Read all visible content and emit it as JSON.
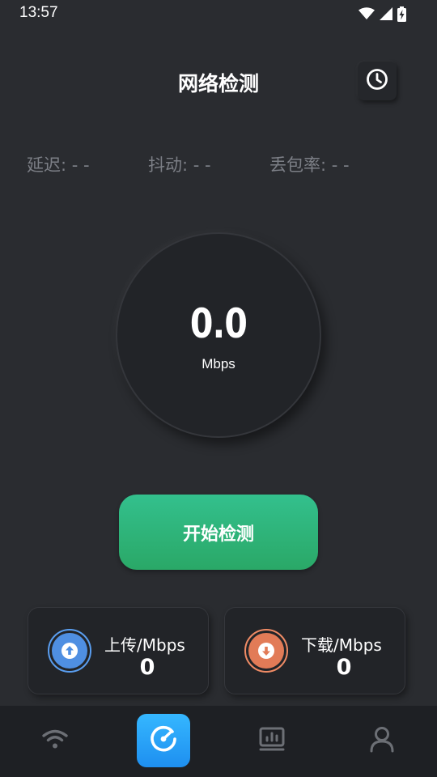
{
  "status_bar": {
    "time": "13:57",
    "icons": [
      "wifi-icon",
      "cellular-signal-icon",
      "battery-charging-icon"
    ]
  },
  "header": {
    "title": "网络检测",
    "history_icon": "clock-icon"
  },
  "metrics": {
    "latency": "延迟: - -",
    "jitter": "抖动: - -",
    "packet_loss": "丢包率: - -"
  },
  "gauge": {
    "value": "0.0",
    "unit": "Mbps"
  },
  "start_button": {
    "label": "开始检测",
    "color": "#2fb67a"
  },
  "upload": {
    "label": "上传/Mbps",
    "value": "0",
    "icon": "arrow-up-icon",
    "color": "#4f8fe2"
  },
  "download": {
    "label": "下载/Mbps",
    "value": "0",
    "icon": "arrow-down-icon",
    "color": "#e27b57"
  },
  "bottom_nav": {
    "items": [
      {
        "icon": "wifi-icon",
        "active": false
      },
      {
        "icon": "speedometer-icon",
        "active": true
      },
      {
        "icon": "report-icon",
        "active": false
      },
      {
        "icon": "profile-icon",
        "active": false
      }
    ],
    "active_color": "#2a9ff5"
  }
}
